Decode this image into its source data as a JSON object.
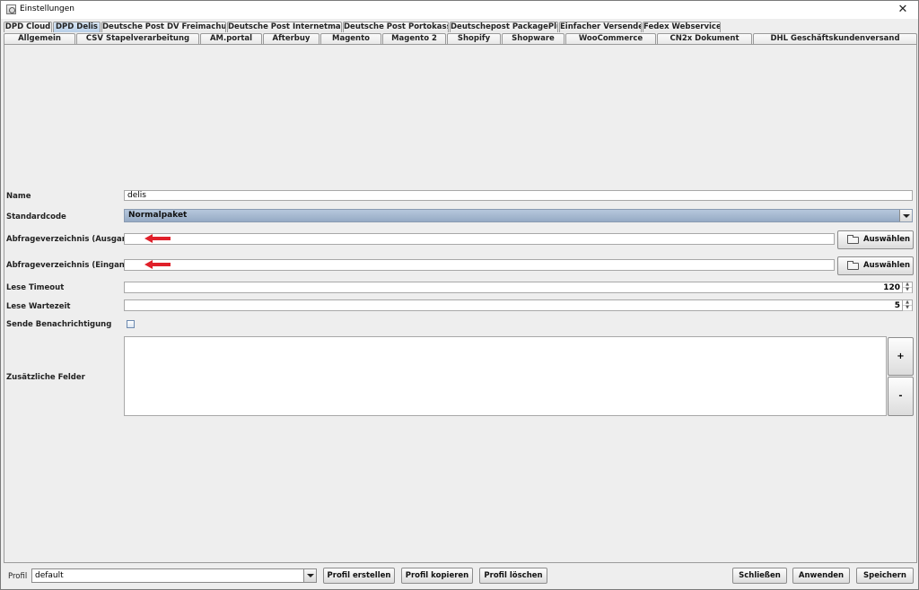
{
  "window": {
    "title": "Einstellungen",
    "close_glyph": "✕"
  },
  "tabs_row1": [
    "DPD Cloud",
    "DPD Delis",
    "Deutsche Post DV Freimachung",
    "Deutsche Post Internetmarke",
    "Deutsche Post Portokasse",
    "Deutschepost PackagePlus",
    "Einfacher Versender",
    "Fedex Webservice"
  ],
  "tabs_row1_active": "DPD Delis",
  "tabs_row2": [
    "Allgemein",
    "CSV Stapelverarbeitung",
    "AM.portal",
    "Afterbuy",
    "Magento",
    "Magento 2",
    "Shopify",
    "Shopware",
    "WooCommerce",
    "CN2x Dokument",
    "DHL Geschäftskundenversand"
  ],
  "form": {
    "name_label": "Name",
    "name_value": "delis",
    "standardcode_label": "Standardcode",
    "standardcode_value": "Normalpaket",
    "ausgang_label": "Abfrageverzeichnis (Ausgang) *",
    "ausgang_value": "",
    "eingang_label": "Abfrageverzeichnis (Eingang) *",
    "eingang_value": "",
    "browse_label": "Auswählen",
    "lese_timeout_label": "Lese Timeout",
    "lese_timeout_value": "120",
    "lese_wartezeit_label": "Lese Wartezeit",
    "lese_wartezeit_value": "5",
    "benachrichtigung_label": "Sende Benachrichtigung",
    "benachrichtigung_checked": false,
    "zusatz_label": "Zusätzliche Felder",
    "add_label": "+",
    "remove_label": "-"
  },
  "bottom": {
    "profil_label": "Profil",
    "profil_value": "default",
    "create_label": "Profil erstellen",
    "copy_label": "Profil kopieren",
    "delete_label": "Profil löschen",
    "close_label": "Schließen",
    "apply_label": "Anwenden",
    "save_label": "Speichern"
  },
  "colors": {
    "annotation_arrow": "#e0202a",
    "active_tab": "#c4d7ee",
    "combo_selected": "#a7bad3"
  }
}
